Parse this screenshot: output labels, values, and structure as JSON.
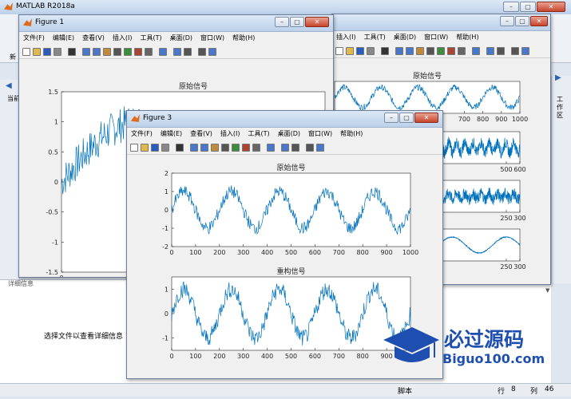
{
  "matlab": {
    "title": "MATLAB R2018a",
    "tab_stub": "新",
    "side_label_left": "当前",
    "side_label_right": "工作区",
    "detail_label": "详细信息",
    "detail_message": "选择文件以查看详细信息",
    "status": {
      "script": "脚本",
      "row_label": "行",
      "row": "8",
      "col_label": "列",
      "col": "46"
    }
  },
  "menus": [
    "文件(F)",
    "编辑(E)",
    "查看(V)",
    "插入(I)",
    "工具(T)",
    "桌面(D)",
    "窗口(W)",
    "帮助(H)"
  ],
  "figure1": {
    "title": "Figure 1"
  },
  "figure2": {
    "title": ""
  },
  "figure3": {
    "title": "Figure 3"
  },
  "watermark": {
    "brand": "必过源码",
    "url": "Biguo100.com"
  },
  "colors": {
    "line": "#0072bd",
    "titlebar": "#c7d8ee",
    "background": "#f0f0f0"
  },
  "chart_data": [
    {
      "id": "fig1",
      "type": "line",
      "title": "原始信号",
      "ylim": [
        -1.5,
        1.5
      ],
      "yticks": [
        -1.5,
        -1,
        -0.5,
        0,
        0.5,
        1,
        1.5
      ],
      "xticks": [
        0,
        100,
        200
      ],
      "xlim_visible": [
        0,
        260
      ],
      "signal": {
        "amplitude": 1,
        "period": 300,
        "noise": 0.3
      }
    },
    {
      "id": "fig2-a",
      "type": "line",
      "title": "原始信号",
      "xticks": [
        700,
        800,
        900,
        1000
      ],
      "xlim": [
        0,
        1000
      ],
      "signal": {
        "amplitude": 1,
        "period": 200,
        "noise": 0.3
      }
    },
    {
      "id": "fig2-b",
      "type": "line",
      "xticks": [
        500,
        600
      ],
      "xlim": [
        0,
        600
      ],
      "signal": {
        "amplitude": 0.5,
        "period": 60,
        "noise": 0.6
      }
    },
    {
      "id": "fig2-c",
      "type": "line",
      "xticks": [
        250,
        300
      ],
      "xlim": [
        0,
        300
      ],
      "signal": {
        "amplitude": 0.3,
        "period": 30,
        "noise": 0.6
      }
    },
    {
      "id": "fig2-d",
      "type": "line",
      "xticks": [
        250,
        300
      ],
      "xlim": [
        0,
        300
      ],
      "signal": {
        "amplitude": 0.8,
        "period": 200,
        "noise": 0.05
      }
    },
    {
      "id": "fig3-top",
      "type": "line",
      "title": "原始信号",
      "xlim": [
        0,
        1000
      ],
      "ylim": [
        -2,
        2
      ],
      "xticks": [
        0,
        100,
        200,
        300,
        400,
        500,
        600,
        700,
        800,
        900,
        1000
      ],
      "yticks": [
        -2,
        -1,
        0,
        1,
        2
      ],
      "signal": {
        "amplitude": 1,
        "period": 200,
        "noise": 0.35
      }
    },
    {
      "id": "fig3-bottom",
      "type": "line",
      "title": "重构信号",
      "xlim": [
        0,
        1000
      ],
      "ylim": [
        -1.5,
        1.5
      ],
      "xticks": [
        0,
        100,
        200,
        300,
        400,
        500,
        600,
        700,
        800,
        900
      ],
      "yticks": [
        -1,
        0,
        1
      ],
      "signal": {
        "amplitude": 1,
        "period": 200,
        "noise": 0.35
      }
    }
  ]
}
